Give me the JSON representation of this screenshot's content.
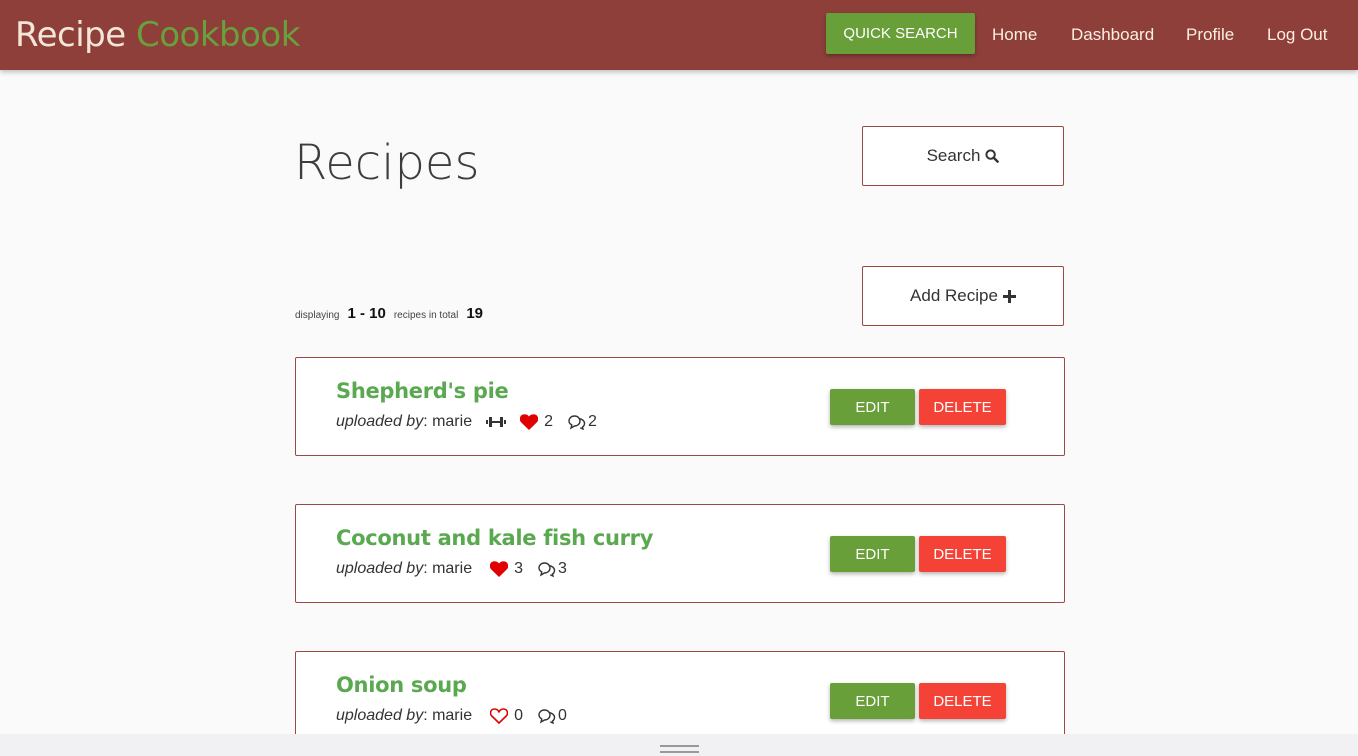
{
  "header": {
    "brand_part1": "Recipe",
    "brand_part2": "Cookbook",
    "quick_search_label": "QUICK SEARCH",
    "nav": [
      {
        "label": "Home"
      },
      {
        "label": "Dashboard"
      },
      {
        "label": "Profile"
      },
      {
        "label": "Log Out"
      }
    ]
  },
  "main": {
    "title": "Recipes",
    "search_button_label": "Search",
    "add_recipe_label": "Add Recipe",
    "counts": {
      "displaying_label": "displaying",
      "range": "1 - 10",
      "total_label": "recipes in total",
      "total": "19"
    }
  },
  "recipes": [
    {
      "title": "Shepherd's pie",
      "uploaded_by_label": "uploaded by",
      "author": "marie",
      "has_fitness_icon": true,
      "liked": true,
      "likes": "2",
      "comments": "2"
    },
    {
      "title": "Coconut and kale fish curry",
      "uploaded_by_label": "uploaded by",
      "author": "marie",
      "has_fitness_icon": false,
      "liked": true,
      "likes": "3",
      "comments": "3"
    },
    {
      "title": "Onion soup",
      "uploaded_by_label": "uploaded by",
      "author": "marie",
      "has_fitness_icon": false,
      "liked": false,
      "likes": "0",
      "comments": "0"
    }
  ],
  "actions": {
    "edit_label": "EDIT",
    "delete_label": "DELETE"
  },
  "icons": {
    "search": "search-icon",
    "add": "plus-icon",
    "heart": "heart-icon",
    "comment": "comments-icon",
    "fitness": "dumbbell-icon"
  },
  "colors": {
    "navbar": "#8e3f3a",
    "brand_accent": "#6aa03c",
    "primary_green": "#689f38",
    "danger_red": "#f44336",
    "recipe_title": "#5aa84f",
    "heart": "#e00000"
  }
}
